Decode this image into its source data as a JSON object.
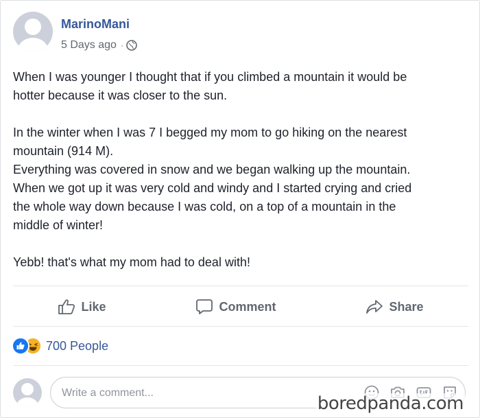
{
  "post": {
    "author": "MarinoMani",
    "timestamp": "5 Days ago",
    "separator": "·",
    "privacy_icon": "globe-icon",
    "paragraphs": [
      [
        "When I was younger I thought that if you climbed a mountain it would be",
        "hotter because it was closer to the sun."
      ],
      [
        "In the winter when I was 7 I begged my mom to go hiking on the nearest",
        "mountain (914 M).",
        "Everything was covered in snow and we began walking up the mountain.",
        "When we got up it was very cold and windy and I started crying and cried",
        "the whole way down because I was cold, on a top of a mountain in the",
        "middle of winter!"
      ],
      [
        "Yebb! that's what my mom had to deal with!"
      ]
    ]
  },
  "actions": {
    "like": "Like",
    "comment": "Comment",
    "share": "Share"
  },
  "reactions": {
    "icons": [
      "like-reaction-icon",
      "haha-reaction-icon"
    ],
    "count_text": "700 People"
  },
  "comment_input": {
    "placeholder": "Write a comment...",
    "value": "",
    "icons": [
      "emoji-icon",
      "camera-icon",
      "gif-icon",
      "sticker-icon"
    ]
  },
  "watermark": "boredpanda.com",
  "colors": {
    "link_blue": "#365899",
    "like_blue": "#1877f2",
    "haha_yellow": "#f7b125",
    "muted_gray": "#606770",
    "avatar_gray": "#ccd0da"
  }
}
